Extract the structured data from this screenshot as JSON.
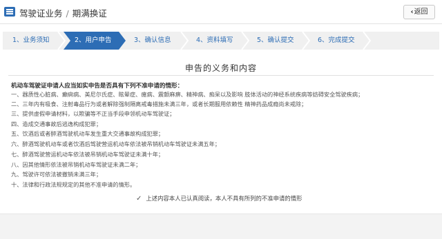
{
  "header": {
    "title": "驾驶证业务",
    "subtitle": "期满换证",
    "back_label": "返回"
  },
  "steps": [
    {
      "label": "1、业务须知"
    },
    {
      "label": "2、用户申告"
    },
    {
      "label": "3、确认信息"
    },
    {
      "label": "4、资料填写"
    },
    {
      "label": "5、确认提交"
    },
    {
      "label": "6、完成提交"
    }
  ],
  "active_step": 2,
  "content": {
    "title": "申告的义务和内容",
    "intro": "机动车驾驶证申请人应当如实申告是否具有下列不准申请的情形：",
    "items": [
      "一、器质性心脏病、癫痫病、美尼尔氏症、眩晕症、癔病、震颤麻痹、精神病、痴呆以及影响 肢体活动的神经系统疾病等妨碍安全驾驶疾病；",
      "二、三年内有吸食、注射毒品行为或者解除强制隔离戒毒措施未满三年，或者长期服用依赖性 精神药品成瘾尚未戒除；",
      "三、提供虚假申请材料，以欺骗等不正当手段申领机动车驾驶证；",
      "四、造成交通事故后逃逸构成犯罪；",
      "五、饮酒后或者醉酒驾驶机动车发生重大交通事故构成犯罪；",
      "六、醉酒驾驶机动车或者饮酒后驾驶营运机动车依法被吊销机动车驾驶证未满五年；",
      "七、醉酒驾驶营运机动车依法被吊销机动车驾驶证未满十年；",
      "八、因其他情形依法被吊销机动车驾驶证未满二年；",
      "九、驾驶许可依法被撤销未满三年；",
      "十、法律和行政法规规定的其他不准申请的情形。"
    ],
    "confirm_label": "上述内容本人已认真阅读，本人不具有所列的不准申请的情形"
  },
  "colors": {
    "accent": "#2d6db5",
    "step_bg": "#f0f0f0"
  }
}
